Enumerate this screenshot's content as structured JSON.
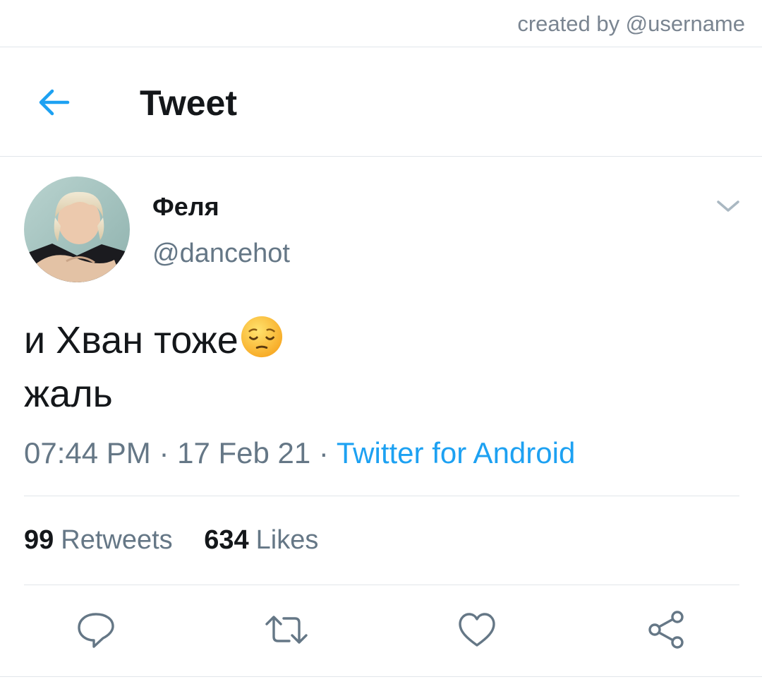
{
  "credit": {
    "text": "created by @username"
  },
  "header": {
    "back_icon": "arrow-left-icon",
    "title": "Tweet"
  },
  "tweet": {
    "author": {
      "display_name": "Феля",
      "handle": "@dancehot"
    },
    "text_lines": [
      "и Хван тоже",
      "жаль"
    ],
    "emoji": "pensive-face",
    "time": "07:44 PM",
    "separator": " · ",
    "date": "17 Feb 21",
    "source": "Twitter for Android",
    "stats": {
      "retweets_count": "99",
      "retweets_label": "Retweets",
      "likes_count": "634",
      "likes_label": "Likes"
    },
    "actions": [
      "reply-icon",
      "retweet-icon",
      "like-icon",
      "share-icon"
    ]
  },
  "colors": {
    "accent": "#1da1f2",
    "text_primary": "#14171a",
    "text_secondary": "#657786",
    "divider": "#e1e6ea",
    "icon_gray": "#657786"
  }
}
